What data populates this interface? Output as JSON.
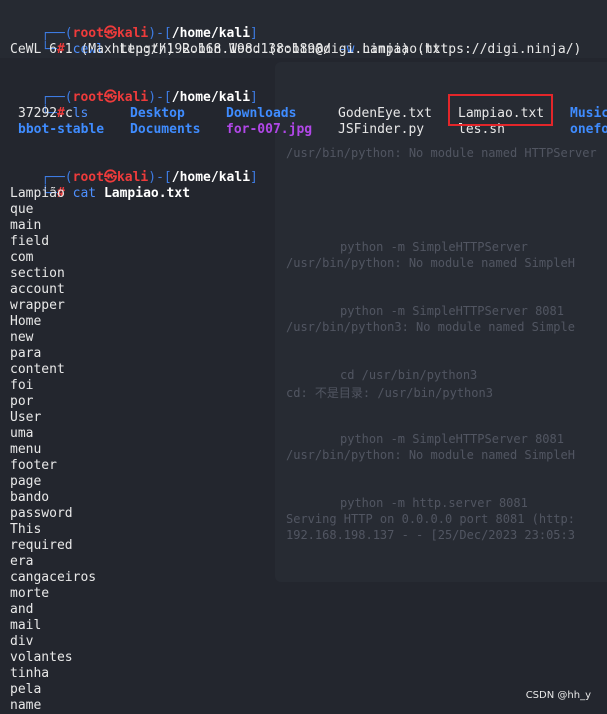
{
  "prompt": {
    "user": "root",
    "host": "kali",
    "skull": "㉿",
    "path": "/home/kali",
    "symbol": "#"
  },
  "cmd1": {
    "command": "cewl",
    "args": "http://192.168.198.138:1898/",
    "flag": "-w",
    "file": "Lampiao.txt"
  },
  "cewl_output": "CeWL 6.1 (Max Length) Robin Wood (robin@digi.ninja) (https://digi.ninja/)",
  "cmd2": {
    "command": "ls"
  },
  "ls_output": {
    "row1": [
      "37292.c",
      "Desktop",
      "Downloads",
      "GodenEye.txt",
      "Lampiao.txt",
      "Music"
    ],
    "row2": [
      "bbot-stable",
      "Documents",
      "for-007.jpg",
      "JSFinder.py",
      "les.sh",
      "onefo"
    ]
  },
  "cmd3": {
    "command": "cat",
    "arg": "Lampiao.txt"
  },
  "wordlist": [
    "Lampião",
    "que",
    "main",
    "field",
    "com",
    "section",
    "account",
    "wrapper",
    "Home",
    "new",
    "para",
    "content",
    "foi",
    "por",
    "User",
    "uma",
    "menu",
    "footer",
    "page",
    "bando",
    "password",
    "This",
    "required",
    "era",
    "cangaceiros",
    "morte",
    "and",
    "mail",
    "div",
    "volantes",
    "tinha",
    "pela",
    "name"
  ],
  "background": {
    "lines": [
      "/usr/bin/python: No module named HTTPServer",
      "python -m SimpleHTTPServer",
      "/usr/bin/python: No module named SimpleH",
      "python -m SimpleHTTPServer 8081",
      "/usr/bin/python3: No module named Simple",
      "cd /usr/bin/python3",
      "cd: 不是目录: /usr/bin/python3",
      "python -m SimpleHTTPServer 8081",
      "/usr/bin/python: No module named SimpleH",
      "python -m http.server 8081",
      "Serving HTTP on 0.0.0.0 port 8081 (http:",
      "192.168.198.137 - - [25/Dec/2023 23:05:3"
    ]
  },
  "watermark": "CSDN @hh_y"
}
